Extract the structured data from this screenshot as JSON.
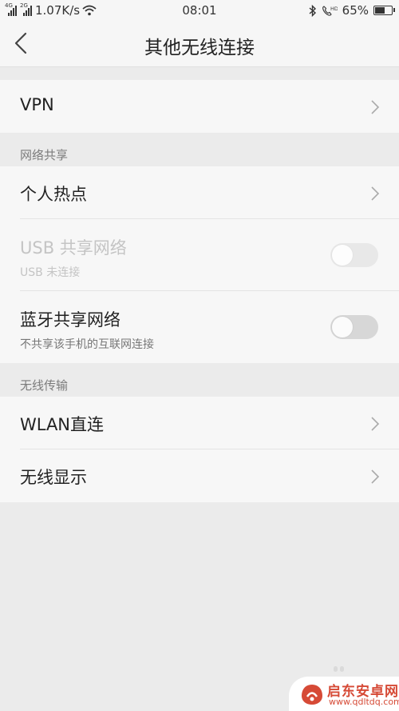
{
  "status_bar": {
    "signal1_type": "4G",
    "signal2_type": "2G",
    "net_speed": "1.07K/s",
    "time": "08:01",
    "battery": "65%",
    "battery_level": 0.65,
    "icons": [
      "signal-icon",
      "wifi-icon",
      "bluetooth-icon",
      "hd-call-icon",
      "battery-icon"
    ]
  },
  "header": {
    "title": "其他无线连接",
    "back_icon": "back-arrow-icon"
  },
  "vpn": {
    "label": "VPN"
  },
  "tethering": {
    "section_title": "网络共享",
    "hotspot": {
      "label": "个人热点"
    },
    "usb": {
      "label": "USB 共享网络",
      "sub": "USB 未连接",
      "enabled": false,
      "on": false
    },
    "bluetooth": {
      "label": "蓝牙共享网络",
      "sub": "不共享该手机的互联网连接",
      "enabled": true,
      "on": false
    }
  },
  "wireless": {
    "section_title": "无线传输",
    "wlan_direct": {
      "label": "WLAN直连"
    },
    "display": {
      "label": "无线显示"
    }
  },
  "watermark": {
    "name": "启东安卓网",
    "url": "www.qdltdq.com"
  },
  "colors": {
    "background": "#ebebeb",
    "card": "#f7f7f7",
    "watermark_red": "#d64a36"
  }
}
